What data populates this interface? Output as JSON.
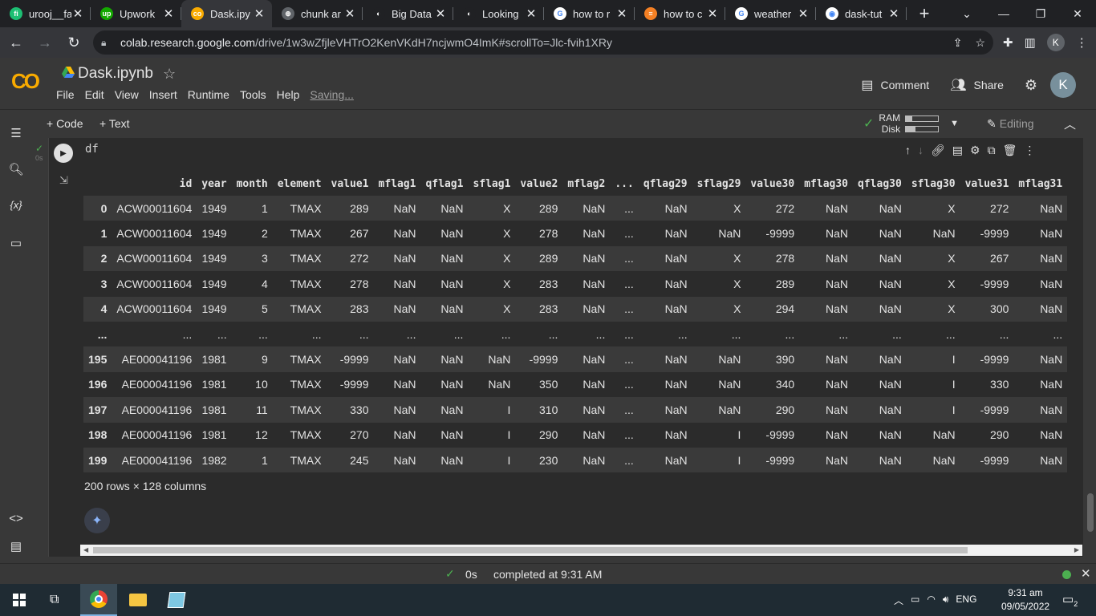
{
  "browser": {
    "tabs": [
      {
        "title": "urooj__fa",
        "fav_color": "#1dbf73",
        "fav_text": "fi"
      },
      {
        "title": "Upwork",
        "fav_color": "#14a800",
        "fav_text": "up"
      },
      {
        "title": "Dask.ipy",
        "fav_color": "#f9ab00",
        "fav_text": "co",
        "active": true
      },
      {
        "title": "chunk ar",
        "fav_color": "#5f6368",
        "fav_text": "⊕"
      },
      {
        "title": "Big Data",
        "fav_color": "#202124",
        "fav_text": "◐"
      },
      {
        "title": "Looking",
        "fav_color": "#202124",
        "fav_text": "◐"
      },
      {
        "title": "how to r",
        "fav_color": "#ffffff",
        "fav_text": "G"
      },
      {
        "title": "how to c",
        "fav_color": "#f48024",
        "fav_text": "≡"
      },
      {
        "title": "weather",
        "fav_color": "#ffffff",
        "fav_text": "G"
      },
      {
        "title": "dask-tut",
        "fav_color": "#ffffff",
        "fav_text": "◉"
      }
    ],
    "url_host": "colab.research.google.com",
    "url_path": "/drive/1w3wZfjleVHTrO2KenVKdH7ncjwmO4ImK#scrollTo=Jlc-fvih1XRy",
    "profile_initial": "K"
  },
  "colab": {
    "title": "Dask.ipynb",
    "menu": [
      "File",
      "Edit",
      "View",
      "Insert",
      "Runtime",
      "Tools",
      "Help"
    ],
    "saving": "Saving...",
    "comment": "Comment",
    "share": "Share",
    "avatar": "K",
    "add_code": "+ Code",
    "add_text": "+ Text",
    "ram_label": "RAM",
    "disk_label": "Disk",
    "ram_fill": 0.2,
    "disk_fill": 0.3,
    "editing": "Editing"
  },
  "cell": {
    "code": "df",
    "exec_time": "0s",
    "columns": [
      "",
      "id",
      "year",
      "month",
      "element",
      "value1",
      "mflag1",
      "qflag1",
      "sflag1",
      "value2",
      "mflag2",
      "...",
      "qflag29",
      "sflag29",
      "value30",
      "mflag30",
      "qflag30",
      "sflag30",
      "value31",
      "mflag31"
    ],
    "rows": [
      [
        "0",
        "ACW00011604",
        "1949",
        "1",
        "TMAX",
        "289",
        "NaN",
        "NaN",
        "X",
        "289",
        "NaN",
        "...",
        "NaN",
        "X",
        "272",
        "NaN",
        "NaN",
        "X",
        "272",
        "NaN"
      ],
      [
        "1",
        "ACW00011604",
        "1949",
        "2",
        "TMAX",
        "267",
        "NaN",
        "NaN",
        "X",
        "278",
        "NaN",
        "...",
        "NaN",
        "NaN",
        "-9999",
        "NaN",
        "NaN",
        "NaN",
        "-9999",
        "NaN"
      ],
      [
        "2",
        "ACW00011604",
        "1949",
        "3",
        "TMAX",
        "272",
        "NaN",
        "NaN",
        "X",
        "289",
        "NaN",
        "...",
        "NaN",
        "X",
        "278",
        "NaN",
        "NaN",
        "X",
        "267",
        "NaN"
      ],
      [
        "3",
        "ACW00011604",
        "1949",
        "4",
        "TMAX",
        "278",
        "NaN",
        "NaN",
        "X",
        "283",
        "NaN",
        "...",
        "NaN",
        "X",
        "289",
        "NaN",
        "NaN",
        "X",
        "-9999",
        "NaN"
      ],
      [
        "4",
        "ACW00011604",
        "1949",
        "5",
        "TMAX",
        "283",
        "NaN",
        "NaN",
        "X",
        "283",
        "NaN",
        "...",
        "NaN",
        "X",
        "294",
        "NaN",
        "NaN",
        "X",
        "300",
        "NaN"
      ],
      [
        "...",
        "...",
        "...",
        "...",
        "...",
        "...",
        "...",
        "...",
        "...",
        "...",
        "...",
        "...",
        "...",
        "...",
        "...",
        "...",
        "...",
        "...",
        "...",
        "..."
      ],
      [
        "195",
        "AE000041196",
        "1981",
        "9",
        "TMAX",
        "-9999",
        "NaN",
        "NaN",
        "NaN",
        "-9999",
        "NaN",
        "...",
        "NaN",
        "NaN",
        "390",
        "NaN",
        "NaN",
        "I",
        "-9999",
        "NaN"
      ],
      [
        "196",
        "AE000041196",
        "1981",
        "10",
        "TMAX",
        "-9999",
        "NaN",
        "NaN",
        "NaN",
        "350",
        "NaN",
        "...",
        "NaN",
        "NaN",
        "340",
        "NaN",
        "NaN",
        "I",
        "330",
        "NaN"
      ],
      [
        "197",
        "AE000041196",
        "1981",
        "11",
        "TMAX",
        "330",
        "NaN",
        "NaN",
        "I",
        "310",
        "NaN",
        "...",
        "NaN",
        "NaN",
        "290",
        "NaN",
        "NaN",
        "I",
        "-9999",
        "NaN"
      ],
      [
        "198",
        "AE000041196",
        "1981",
        "12",
        "TMAX",
        "270",
        "NaN",
        "NaN",
        "I",
        "290",
        "NaN",
        "...",
        "NaN",
        "I",
        "-9999",
        "NaN",
        "NaN",
        "NaN",
        "290",
        "NaN"
      ],
      [
        "199",
        "AE000041196",
        "1982",
        "1",
        "TMAX",
        "245",
        "NaN",
        "NaN",
        "I",
        "230",
        "NaN",
        "...",
        "NaN",
        "I",
        "-9999",
        "NaN",
        "NaN",
        "NaN",
        "-9999",
        "NaN"
      ]
    ],
    "shape_text": "200 rows × 128 columns"
  },
  "status": {
    "time": "0s",
    "message": "completed at 9:31 AM"
  },
  "taskbar": {
    "lang": "ENG",
    "time": "9:31 am",
    "date": "09/05/2022",
    "notifications": "2"
  }
}
